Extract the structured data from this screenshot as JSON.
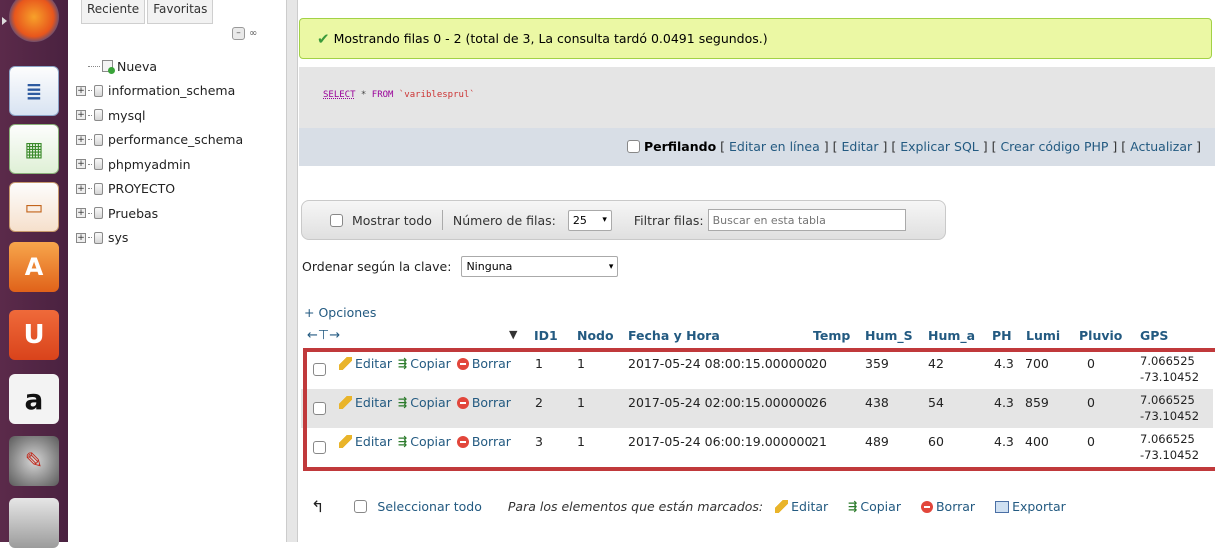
{
  "launcher": {
    "apps": [
      {
        "name": "firefox-icon",
        "glyph": ""
      },
      {
        "name": "writer-icon",
        "glyph": ""
      },
      {
        "name": "calc-icon",
        "glyph": ""
      },
      {
        "name": "impress-icon",
        "glyph": ""
      },
      {
        "name": "software-center-icon",
        "glyph": "A"
      },
      {
        "name": "ubuntu-one-icon",
        "glyph": "U"
      },
      {
        "name": "amazon-icon",
        "glyph": "a"
      },
      {
        "name": "system-settings-icon",
        "glyph": ""
      },
      {
        "name": "drive-icon",
        "glyph": ""
      }
    ]
  },
  "nav": {
    "tabs": [
      "Reciente",
      "Favoritas"
    ],
    "new_label": "Nueva",
    "databases": [
      "information_schema",
      "mysql",
      "performance_schema",
      "phpmyadmin",
      "PROYECTO",
      "Pruebas",
      "sys"
    ]
  },
  "success": {
    "message": "Mostrando filas 0 - 2 (total de 3, La consulta tardó 0.0491 segundos.)"
  },
  "sql": {
    "keyword1": "SELECT",
    "middle": " * ",
    "keyword2": "FROM",
    "table": " `variblesprul`"
  },
  "sql_links": {
    "profiling": "Perfilando",
    "edit_inline": "Editar en línea",
    "edit": "Editar",
    "explain": "Explicar SQL",
    "php": "Crear código PHP",
    "refresh": "Actualizar"
  },
  "navbar": {
    "show_all": "Mostrar todo",
    "rows_label": "Número de filas:",
    "rows_value": "25",
    "filter_label": "Filtrar filas:",
    "filter_placeholder": "Buscar en esta tabla"
  },
  "sort": {
    "label": "Ordenar según la clave:",
    "value": "Ninguna"
  },
  "options_link": "+ Opciones",
  "columns": [
    "ID1",
    "Nodo",
    "Fecha y Hora",
    "Temp",
    "Hum_S",
    "Hum_a",
    "PH",
    "Lumi",
    "Pluvio",
    "GPS"
  ],
  "row_actions": {
    "edit": "Editar",
    "copy": "Copiar",
    "delete": "Borrar"
  },
  "rows": [
    {
      "ID1": "1",
      "Nodo": "1",
      "Fecha": "2017-05-24 08:00:15.000000",
      "Temp": "20",
      "Hum_S": "359",
      "Hum_a": "42",
      "PH": "4.3",
      "Lumi": "700",
      "Pluvio": "0",
      "GPS1": "7.066525",
      "GPS2": "-73.10452"
    },
    {
      "ID1": "2",
      "Nodo": "1",
      "Fecha": "2017-05-24 02:00:15.000000",
      "Temp": "26",
      "Hum_S": "438",
      "Hum_a": "54",
      "PH": "4.3",
      "Lumi": "859",
      "Pluvio": "0",
      "GPS1": "7.066525",
      "GPS2": "-73.10452"
    },
    {
      "ID1": "3",
      "Nodo": "1",
      "Fecha": "2017-05-24 06:00:19.000000",
      "Temp": "21",
      "Hum_S": "489",
      "Hum_a": "60",
      "PH": "4.3",
      "Lumi": "400",
      "Pluvio": "0",
      "GPS1": "7.066525",
      "GPS2": "-73.10452"
    }
  ],
  "bottom": {
    "select_all": "Seleccionar todo",
    "with_selected": "Para los elementos que están marcados:",
    "edit": "Editar",
    "copy": "Copiar",
    "delete": "Borrar",
    "export": "Exportar"
  }
}
